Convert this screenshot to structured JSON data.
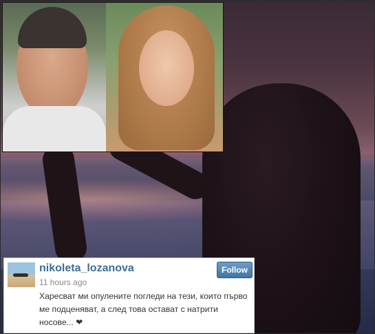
{
  "post": {
    "username": "nikoleta_lozanova",
    "time": "11 hours ago",
    "follow_label": "Follow",
    "text": "Харесват ми опулените погледи на тези, които първо ме подценяват, а след това остават с натрити носове... ❤"
  },
  "colors": {
    "username": "#3d6e95",
    "follow_bg": "#4f84b0"
  }
}
